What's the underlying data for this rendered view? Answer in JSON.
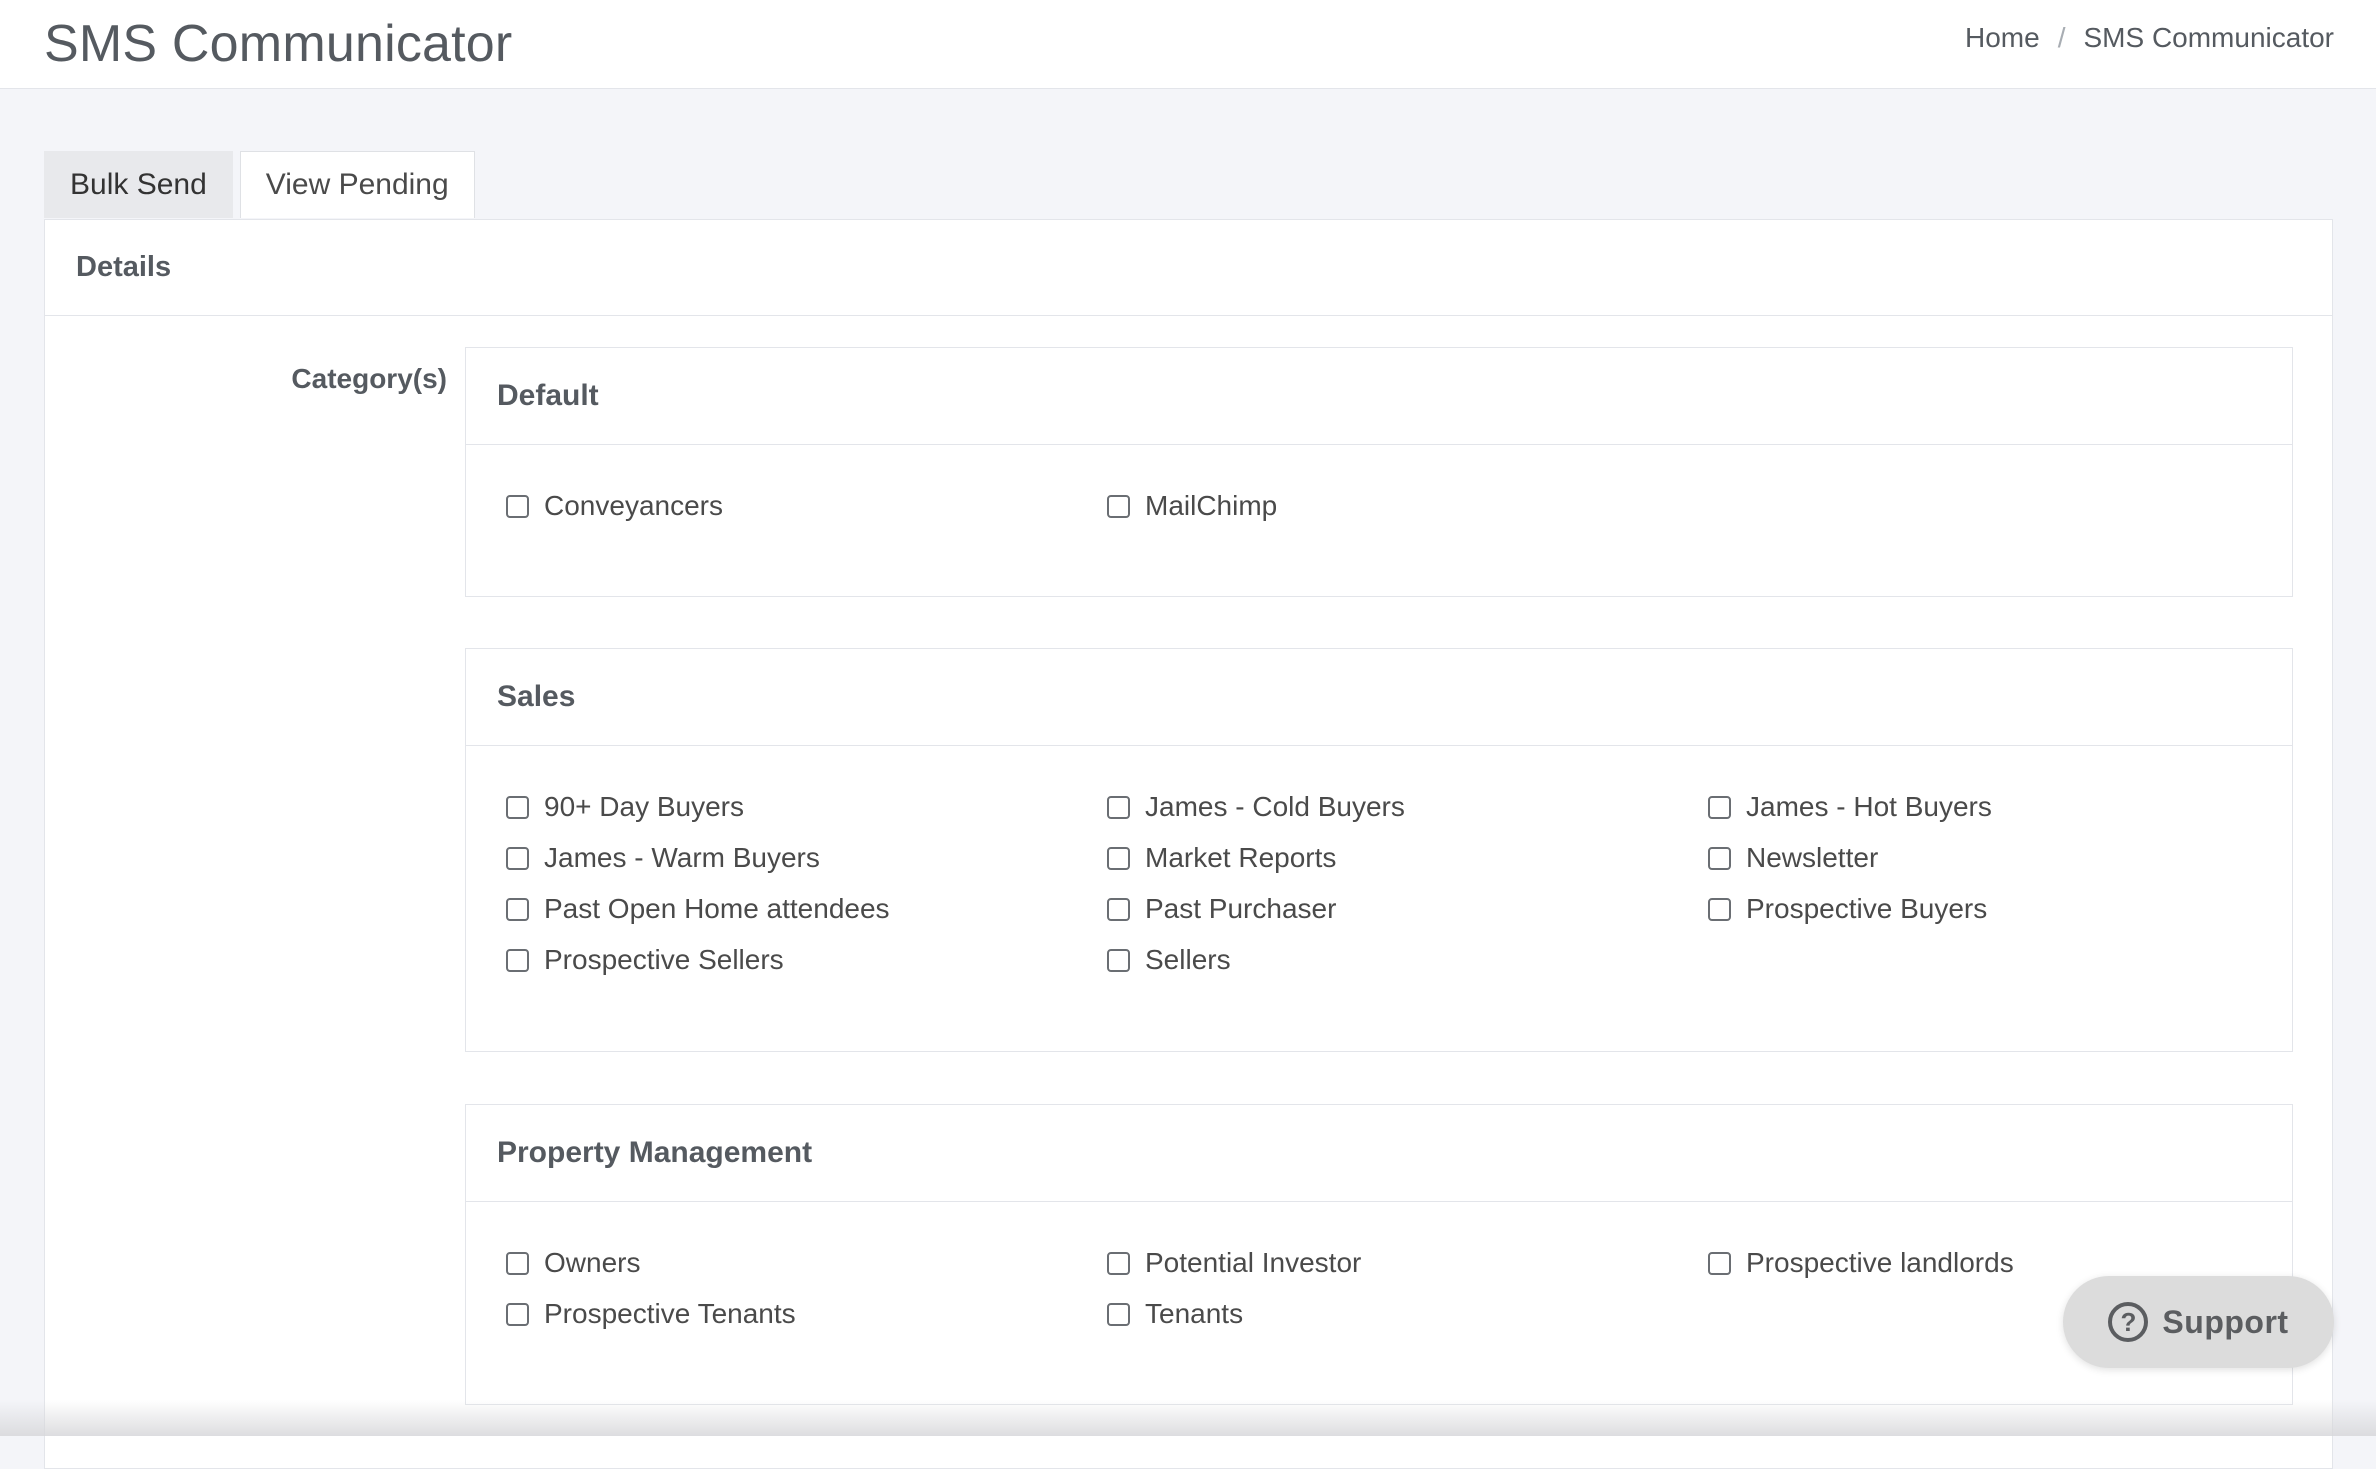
{
  "header": {
    "title": "SMS Communicator",
    "breadcrumb": [
      {
        "label": "Home"
      },
      {
        "label": "SMS Communicator"
      }
    ],
    "breadcrumb_separator": "/"
  },
  "tabs": [
    {
      "label": "Bulk Send",
      "active": true
    },
    {
      "label": "View Pending",
      "active": false
    }
  ],
  "panel": {
    "title": "Details",
    "field_label": "Category(s)"
  },
  "groups": [
    {
      "title": "Default",
      "items": [
        "Conveyancers",
        "MailChimp"
      ]
    },
    {
      "title": "Sales",
      "items": [
        "90+ Day Buyers",
        "James - Cold Buyers",
        "James - Hot Buyers",
        "James - Warm Buyers",
        "Market Reports",
        "Newsletter",
        "Past Open Home attendees",
        "Past Purchaser",
        "Prospective Buyers",
        "Prospective Sellers",
        "Sellers"
      ]
    },
    {
      "title": "Property Management",
      "items": [
        "Owners",
        "Potential Investor",
        "Prospective landlords",
        "Prospective Tenants",
        "Tenants"
      ]
    }
  ],
  "support": {
    "label": "Support",
    "icon": "question-circle-icon",
    "icon_glyph": "?"
  },
  "colors": {
    "background": "#f4f5f9",
    "active_tab": "#e8e9ec",
    "support_button": "#dcdcdc"
  }
}
